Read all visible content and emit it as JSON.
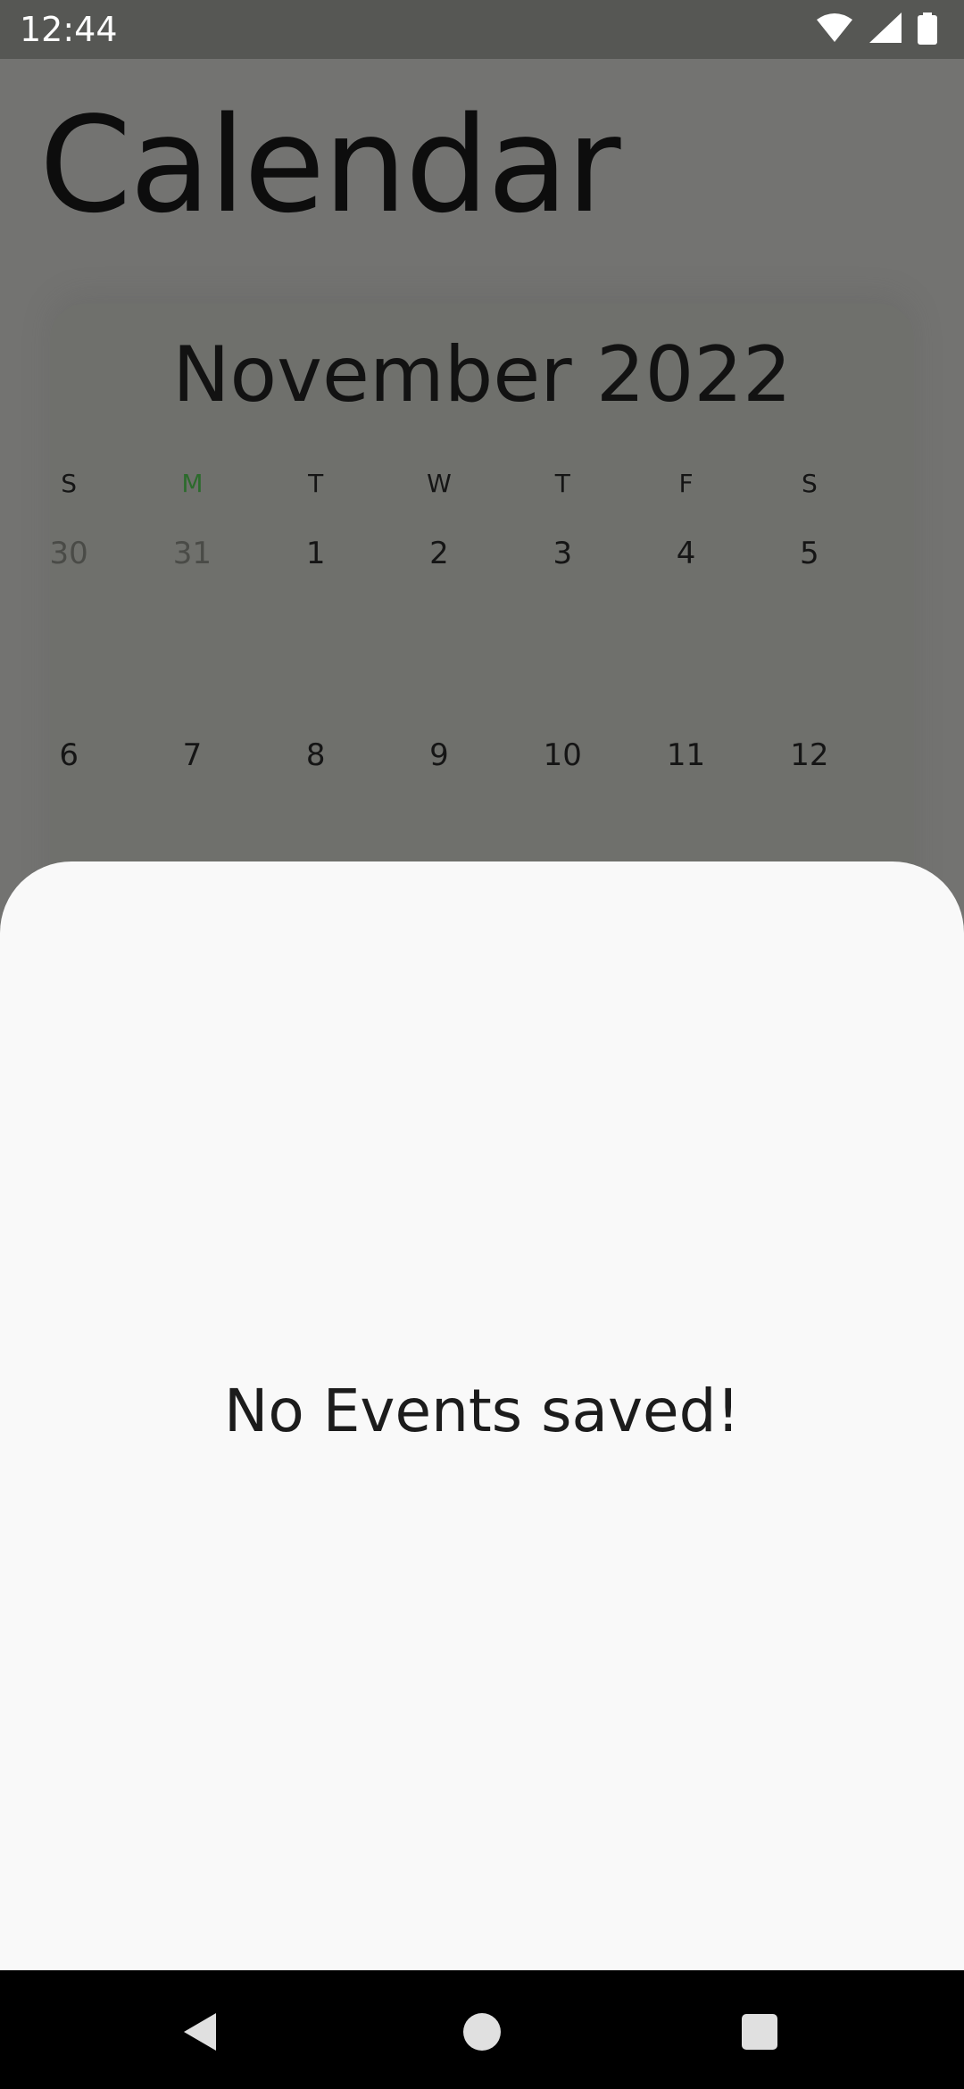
{
  "status_bar": {
    "time": "12:44",
    "icons": [
      "wifi-icon",
      "signal-icon",
      "battery-icon"
    ]
  },
  "page": {
    "title": "Calendar"
  },
  "calendar": {
    "month_label": "November 2022",
    "weekdays": [
      "S",
      "M",
      "T",
      "W",
      "T",
      "F",
      "S"
    ],
    "highlighted_weekday": "M",
    "weeks": [
      [
        "30",
        "31",
        "1",
        "2",
        "3",
        "4",
        "5"
      ],
      [
        "6",
        "7",
        "8",
        "9",
        "10",
        "11",
        "12"
      ]
    ]
  },
  "sheet": {
    "empty_message": "No Events saved!"
  },
  "nav_bar": {
    "buttons": [
      "back-icon",
      "home-icon",
      "recents-icon"
    ]
  },
  "colors": {
    "scrim": "#737371",
    "sheet_background": "#f9f9f9",
    "today_accent": "#2c6b2c",
    "nav_background": "#000000"
  }
}
